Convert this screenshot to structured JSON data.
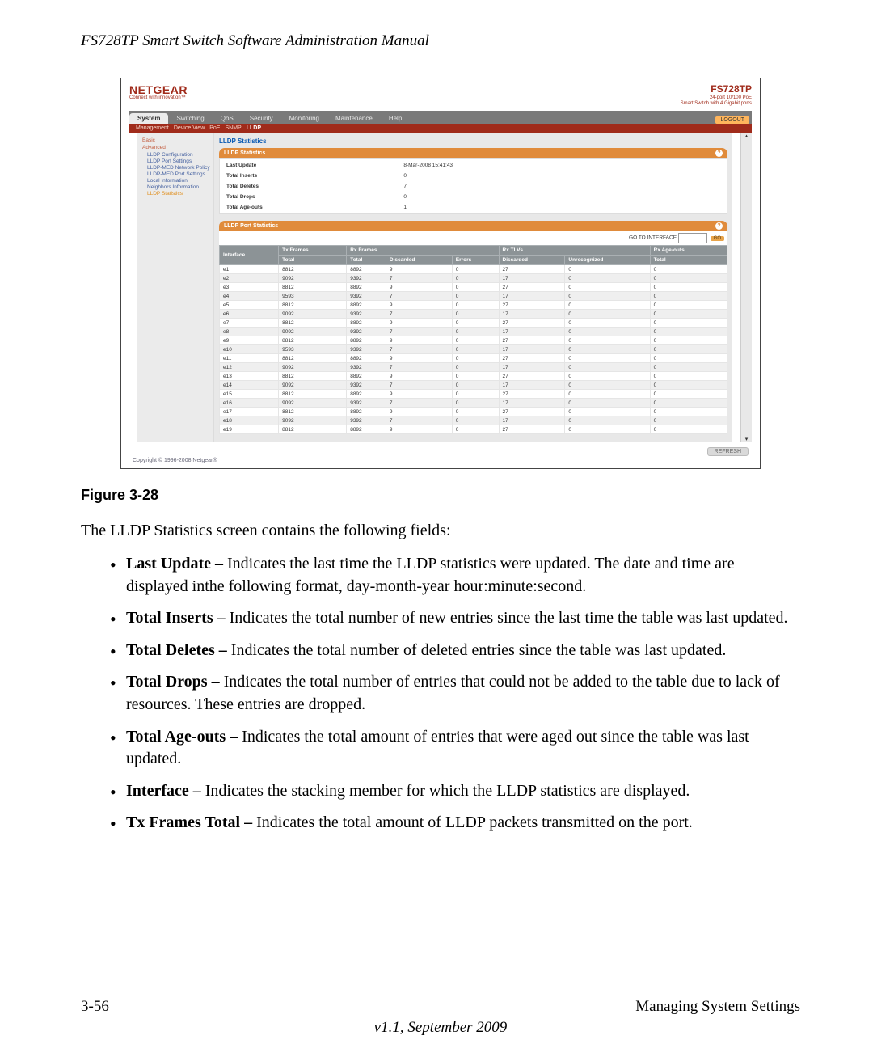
{
  "doc_title": "FS728TP Smart Switch Software Administration Manual",
  "brand": "NETGEAR",
  "brand_tag": "Connect with innovation™",
  "model": "FS728TP",
  "model_sub1": "24-port 10/100 PoE",
  "model_sub2": "Smart Switch with 4 Gigabit ports",
  "logout": "LOGOUT",
  "tabs": [
    "System",
    "Switching",
    "QoS",
    "Security",
    "Monitoring",
    "Maintenance",
    "Help"
  ],
  "subtabs": [
    "Management",
    "Device View",
    "PoE",
    "SNMP",
    "LLDP"
  ],
  "subtab_active": "LLDP",
  "sidebar": {
    "basic": "Basic",
    "advanced": "Advanced",
    "items": [
      "LLDP Configuration",
      "LLDP Port Settings",
      "LLDP-MED Network Policy",
      "LLDP-MED Port Settings",
      "Local Information",
      "Neighbors Information",
      "LLDP Statistics"
    ]
  },
  "panel_title": "LLDP Statistics",
  "stats_bar": "LLDP Statistics",
  "last_update": {
    "label": "Last Update",
    "value": "8-Mar-2008 15:41:43"
  },
  "total_inserts": {
    "label": "Total Inserts",
    "value": "0"
  },
  "total_deletes": {
    "label": "Total Deletes",
    "value": "7"
  },
  "total_drops": {
    "label": "Total Drops",
    "value": "0"
  },
  "total_ageouts": {
    "label": "Total Age-outs",
    "value": "1"
  },
  "port_bar": "LLDP Port Statistics",
  "go_to_if": "GO TO INTERFACE",
  "go_btn": "GO",
  "port_headers": {
    "interface": "Interface",
    "tx": "Tx Frames",
    "rx": "Rx Frames",
    "tlv": "Rx TLVs",
    "age": "Rx Age-outs",
    "total": "Total",
    "discarded": "Discarded",
    "errors": "Errors",
    "unrec": "Unrecognized"
  },
  "port_rows": [
    {
      "iface": "e1",
      "txt": "8812",
      "rt": "8892",
      "rd": "9",
      "re": "0",
      "td": "27",
      "tu": "0",
      "ao": "0"
    },
    {
      "iface": "e2",
      "txt": "9092",
      "rt": "9392",
      "rd": "7",
      "re": "0",
      "td": "17",
      "tu": "0",
      "ao": "0"
    },
    {
      "iface": "e3",
      "txt": "8812",
      "rt": "8892",
      "rd": "9",
      "re": "0",
      "td": "27",
      "tu": "0",
      "ao": "0"
    },
    {
      "iface": "e4",
      "txt": "9593",
      "rt": "9392",
      "rd": "7",
      "re": "0",
      "td": "17",
      "tu": "0",
      "ao": "0"
    },
    {
      "iface": "e5",
      "txt": "8812",
      "rt": "8892",
      "rd": "9",
      "re": "0",
      "td": "27",
      "tu": "0",
      "ao": "0"
    },
    {
      "iface": "e6",
      "txt": "9092",
      "rt": "9392",
      "rd": "7",
      "re": "0",
      "td": "17",
      "tu": "0",
      "ao": "0"
    },
    {
      "iface": "e7",
      "txt": "8812",
      "rt": "8892",
      "rd": "9",
      "re": "0",
      "td": "27",
      "tu": "0",
      "ao": "0"
    },
    {
      "iface": "e8",
      "txt": "9092",
      "rt": "9392",
      "rd": "7",
      "re": "0",
      "td": "17",
      "tu": "0",
      "ao": "0"
    },
    {
      "iface": "e9",
      "txt": "8812",
      "rt": "8892",
      "rd": "9",
      "re": "0",
      "td": "27",
      "tu": "0",
      "ao": "0"
    },
    {
      "iface": "e10",
      "txt": "9593",
      "rt": "9392",
      "rd": "7",
      "re": "0",
      "td": "17",
      "tu": "0",
      "ao": "0"
    },
    {
      "iface": "e11",
      "txt": "8812",
      "rt": "8892",
      "rd": "9",
      "re": "0",
      "td": "27",
      "tu": "0",
      "ao": "0"
    },
    {
      "iface": "e12",
      "txt": "9092",
      "rt": "9392",
      "rd": "7",
      "re": "0",
      "td": "17",
      "tu": "0",
      "ao": "0"
    },
    {
      "iface": "e13",
      "txt": "8812",
      "rt": "8892",
      "rd": "9",
      "re": "0",
      "td": "27",
      "tu": "0",
      "ao": "0"
    },
    {
      "iface": "e14",
      "txt": "9092",
      "rt": "9392",
      "rd": "7",
      "re": "0",
      "td": "17",
      "tu": "0",
      "ao": "0"
    },
    {
      "iface": "e15",
      "txt": "8812",
      "rt": "8892",
      "rd": "9",
      "re": "0",
      "td": "27",
      "tu": "0",
      "ao": "0"
    },
    {
      "iface": "e16",
      "txt": "9092",
      "rt": "9392",
      "rd": "7",
      "re": "0",
      "td": "17",
      "tu": "0",
      "ao": "0"
    },
    {
      "iface": "e17",
      "txt": "8812",
      "rt": "8892",
      "rd": "9",
      "re": "0",
      "td": "27",
      "tu": "0",
      "ao": "0"
    },
    {
      "iface": "e18",
      "txt": "9092",
      "rt": "9392",
      "rd": "7",
      "re": "0",
      "td": "17",
      "tu": "0",
      "ao": "0"
    },
    {
      "iface": "e19",
      "txt": "8812",
      "rt": "8892",
      "rd": "9",
      "re": "0",
      "td": "27",
      "tu": "0",
      "ao": "0"
    }
  ],
  "refresh": "REFRESH",
  "copyright": "Copyright © 1996-2008 Netgear®",
  "fig_caption": "Figure 3-28",
  "intro": "The LLDP Statistics screen contains the following fields:",
  "bullets": [
    {
      "b": "Last Update –",
      "t": " Indicates the last time the LLDP statistics were updated. The date and time are displayed inthe following format, day-month-year hour:minute:second."
    },
    {
      "b": "Total Inserts –",
      "t": " Indicates the total number of new entries since the last time the table was last updated."
    },
    {
      "b": "Total Deletes –",
      "t": " Indicates the total number of deleted entries since the table was last updated."
    },
    {
      "b": "Total Drops –",
      "t": " Indicates the total number of entries that could not be added to the table due to lack of resources. These entries are dropped."
    },
    {
      "b": "Total Age-outs –",
      "t": " Indicates the total amount of entries that were aged out since the table was last updated."
    },
    {
      "b": "Interface –",
      "t": " Indicates the stacking member for which the LLDP statistics are displayed."
    },
    {
      "b": "Tx Frames Total –",
      "t": " Indicates the total amount of LLDP packets transmitted on the port."
    }
  ],
  "page_num": "3-56",
  "section": "Managing System Settings",
  "version": "v1.1, September 2009"
}
